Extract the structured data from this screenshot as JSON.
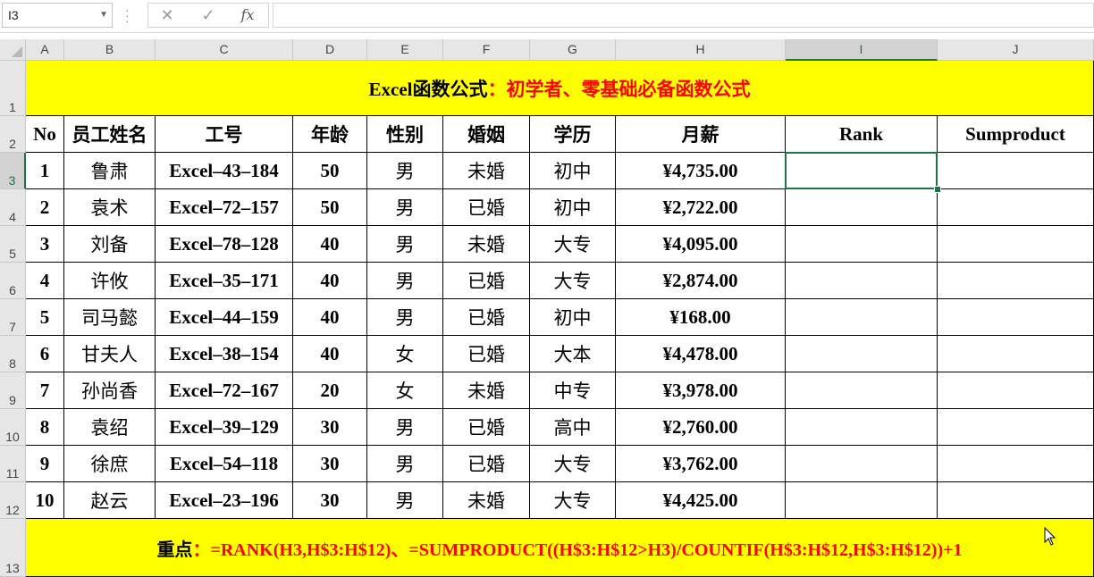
{
  "formula_bar": {
    "name_box": "I3",
    "cancel_glyph": "✕",
    "enter_glyph": "✓",
    "fx_label": "fx",
    "formula": ""
  },
  "columns": [
    "A",
    "B",
    "C",
    "D",
    "E",
    "F",
    "G",
    "H",
    "I",
    "J"
  ],
  "selected_column": "I",
  "selected_row": "3",
  "rows": [
    "1",
    "2",
    "3",
    "4",
    "5",
    "6",
    "7",
    "8",
    "9",
    "10",
    "11",
    "12",
    "13"
  ],
  "title": {
    "part1": "Excel函数公式",
    "part2": "：初学者、零基础必备函数公式"
  },
  "headers": [
    "No",
    "员工姓名",
    "工号",
    "年龄",
    "性别",
    "婚姻",
    "学历",
    "月薪",
    "Rank",
    "Sumproduct"
  ],
  "records": [
    [
      "1",
      "鲁肃",
      "Excel–43–184",
      "50",
      "男",
      "未婚",
      "初中",
      "¥4,735.00",
      "",
      ""
    ],
    [
      "2",
      "袁术",
      "Excel–72–157",
      "50",
      "男",
      "已婚",
      "初中",
      "¥2,722.00",
      "",
      ""
    ],
    [
      "3",
      "刘备",
      "Excel–78–128",
      "40",
      "男",
      "未婚",
      "大专",
      "¥4,095.00",
      "",
      ""
    ],
    [
      "4",
      "许攸",
      "Excel–35–171",
      "40",
      "男",
      "已婚",
      "大专",
      "¥2,874.00",
      "",
      ""
    ],
    [
      "5",
      "司马懿",
      "Excel–44–159",
      "40",
      "男",
      "已婚",
      "初中",
      "¥168.00",
      "",
      ""
    ],
    [
      "6",
      "甘夫人",
      "Excel–38–154",
      "40",
      "女",
      "已婚",
      "大本",
      "¥4,478.00",
      "",
      ""
    ],
    [
      "7",
      "孙尚香",
      "Excel–72–167",
      "20",
      "女",
      "未婚",
      "中专",
      "¥3,978.00",
      "",
      ""
    ],
    [
      "8",
      "袁绍",
      "Excel–39–129",
      "30",
      "男",
      "已婚",
      "高中",
      "¥2,760.00",
      "",
      ""
    ],
    [
      "9",
      "徐庶",
      "Excel–54–118",
      "30",
      "男",
      "已婚",
      "大专",
      "¥3,762.00",
      "",
      ""
    ],
    [
      "10",
      "赵云",
      "Excel–23–196",
      "30",
      "男",
      "未婚",
      "大专",
      "¥4,425.00",
      "",
      ""
    ]
  ],
  "footer": {
    "label": "重点",
    "formula": "：=RANK(H3,H$3:H$12)、=SUMPRODUCT((H$3:H$12>H3)/COUNTIF(H$3:H$12,H$3:H$12))+1"
  },
  "colors": {
    "banner_bg": "#ffff00",
    "accent_red": "#ff0000",
    "selection_green": "#217346"
  }
}
